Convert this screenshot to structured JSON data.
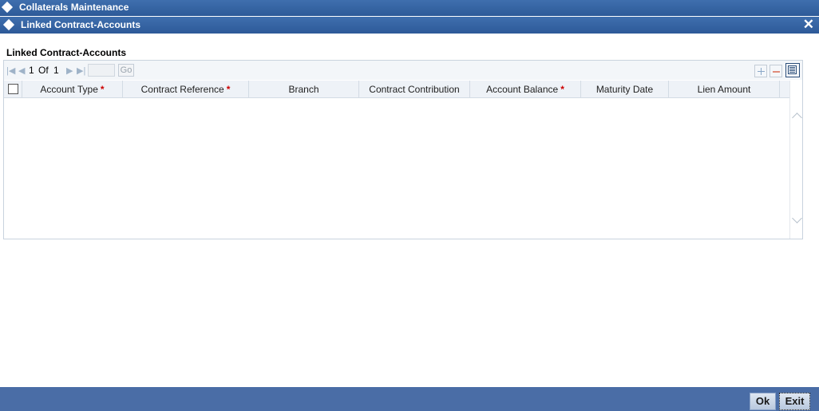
{
  "window": {
    "outer_title": "Collaterals Maintenance",
    "inner_title": "Linked Contract-Accounts",
    "close_icon": "close-icon"
  },
  "section": {
    "title": "Linked Contract-Accounts"
  },
  "pager": {
    "current_page": "1",
    "of_label": "Of",
    "total_pages": "1",
    "go_label": "Go",
    "page_input_value": ""
  },
  "toolbar": {
    "add_icon": "plus-icon",
    "delete_icon": "minus-icon",
    "view_icon": "single-view-icon"
  },
  "table": {
    "columns": [
      {
        "label": "Account Type",
        "required": "*"
      },
      {
        "label": "Contract Reference",
        "required": "*"
      },
      {
        "label": "Branch",
        "required": ""
      },
      {
        "label": "Contract Contribution",
        "required": ""
      },
      {
        "label": "Account Balance",
        "required": "*"
      },
      {
        "label": "Maturity Date",
        "required": ""
      },
      {
        "label": "Lien Amount",
        "required": ""
      }
    ],
    "rows": []
  },
  "footer": {
    "ok_label": "Ok",
    "exit_label": "Exit"
  },
  "colors": {
    "title_bar": "#2d5a98",
    "footer_bar": "#4a6da6",
    "required_mark": "#cc0000"
  }
}
